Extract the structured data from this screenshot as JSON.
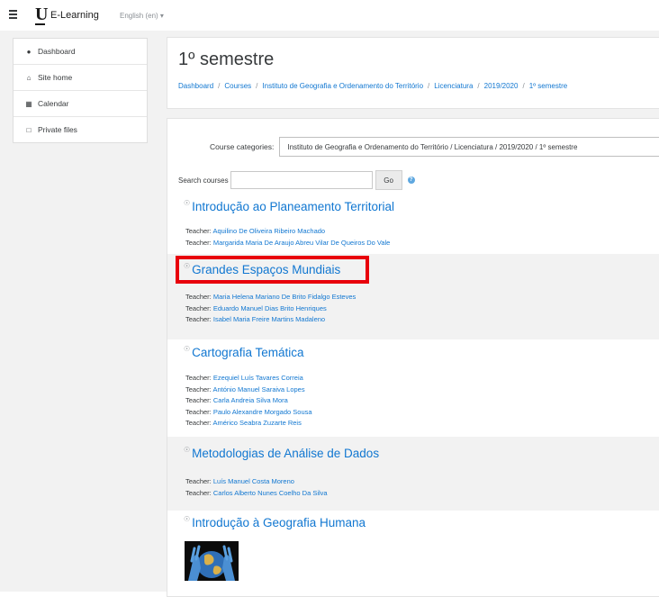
{
  "navbar": {
    "brand": "E-Learning",
    "language": "English (en) ▾"
  },
  "drawer": {
    "items": [
      {
        "label": "Dashboard",
        "icon": "tachometer-icon"
      },
      {
        "label": "Site home",
        "icon": "home-icon"
      },
      {
        "label": "Calendar",
        "icon": "calendar-icon"
      },
      {
        "label": "Private files",
        "icon": "file-icon"
      }
    ]
  },
  "header": {
    "title": "1º semestre",
    "breadcrumb": [
      "Dashboard",
      "Courses",
      "Instituto de Geografia e Ordenamento do Território",
      "Licenciatura",
      "2019/2020",
      "1º semestre"
    ]
  },
  "filters": {
    "categories_label": "Course categories:",
    "categories_value": "Instituto de Geografia e Ordenamento do Território / Licenciatura / 2019/2020 / 1º semestre",
    "search_label": "Search courses",
    "search_value": "",
    "go_label": "Go"
  },
  "courses": [
    {
      "title": "Introdução ao Planeamento Territorial",
      "teachers": [
        "Aquilino De Oliveira Ribeiro Machado",
        "Margarida Maria De Araujo Abreu Vilar De Queiros Do Vale"
      ]
    },
    {
      "title": "Grandes Espaços Mundiais",
      "teachers": [
        "Maria Helena Mariano De Brito Fidalgo Esteves",
        "Eduardo Manuel Dias Brito Henriques",
        "Isabel Maria Freire Martins Madaleno"
      ]
    },
    {
      "title": "Cartografia Temática",
      "teachers": [
        "Ezequiel Luís Tavares Correia",
        "António Manuel Saraiva Lopes",
        "Carla Andreia Silva Mora",
        "Paulo Alexandre Morgado Sousa",
        "Américo Seabra Zuzarte Reis"
      ]
    },
    {
      "title": "Metodologias de Análise de Dados",
      "teachers": [
        "Luís Manuel Costa Moreno",
        "Carlos Alberto Nunes Coelho Da Silva"
      ]
    },
    {
      "title": "Introdução à Geografia Humana",
      "teachers": []
    }
  ],
  "teacher_role": "Teacher:",
  "colors": {
    "link": "#1177d1",
    "highlight": "#e8000b",
    "background": "#f2f2f2"
  }
}
